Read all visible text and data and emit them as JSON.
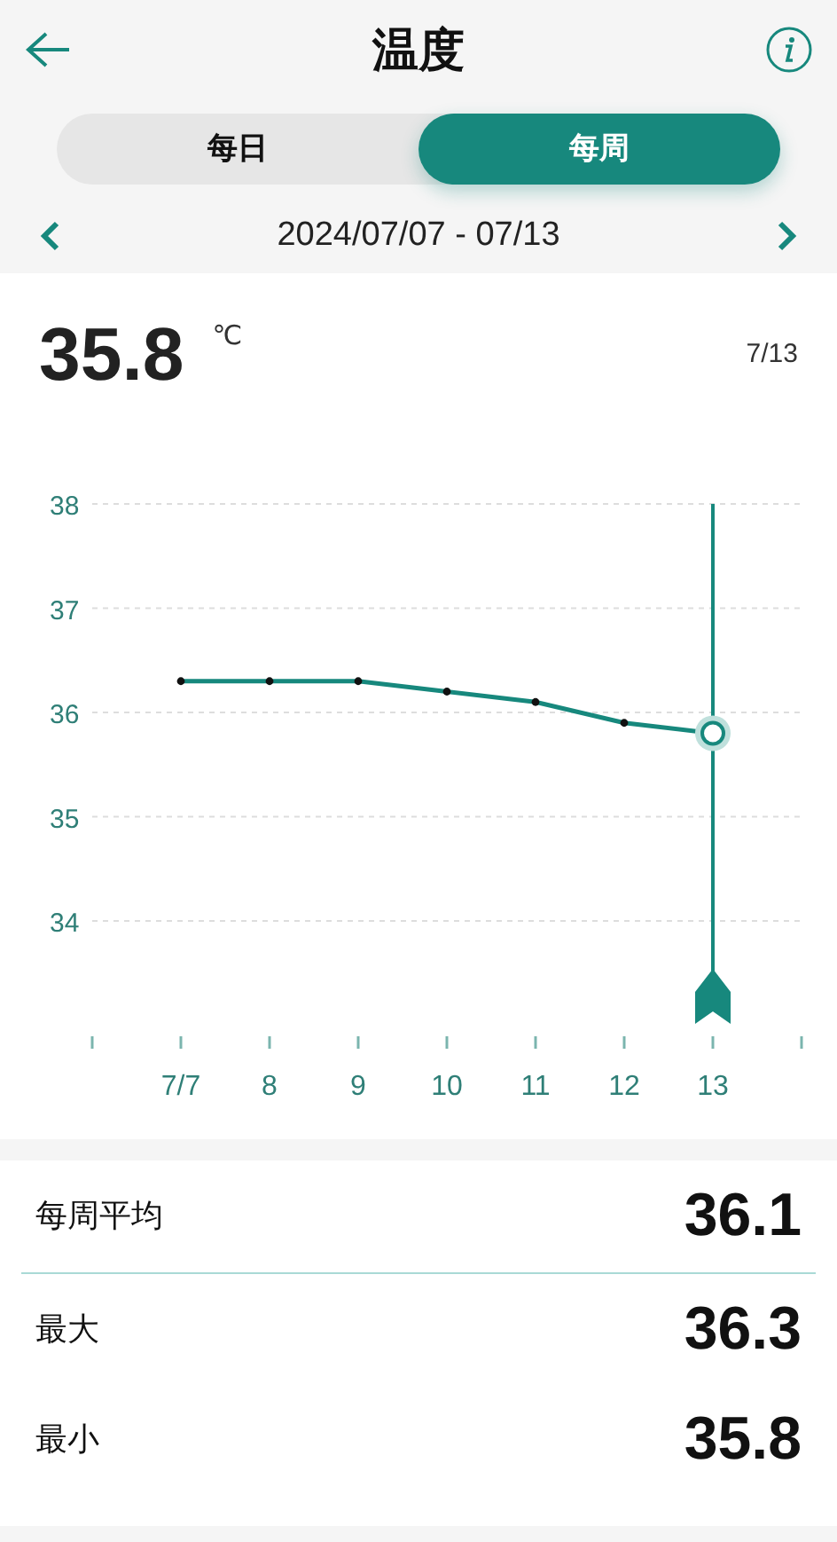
{
  "header": {
    "title": "温度"
  },
  "tabs": [
    {
      "label": "每日",
      "selected": false
    },
    {
      "label": "每周",
      "selected": true
    }
  ],
  "date_range": "2024/07/07 - 07/13",
  "reading": {
    "value": "35.8",
    "unit": "℃",
    "date": "7/13"
  },
  "chart_data": {
    "type": "line",
    "categories": [
      "7/7",
      "8",
      "9",
      "10",
      "11",
      "12",
      "13"
    ],
    "series": [
      {
        "color": "#17887d",
        "values": [
          36.3,
          36.3,
          36.3,
          36.2,
          36.1,
          35.9,
          35.8
        ]
      }
    ],
    "ylim": [
      34,
      38
    ],
    "yticks": [
      34,
      35,
      36,
      37,
      38
    ],
    "grid": true,
    "marker": true,
    "ref_lines": [
      {
        "axis": "x",
        "value": "13",
        "color": "#17887d"
      }
    ]
  },
  "stats": [
    {
      "label": "每周平均",
      "value": "36.1"
    },
    {
      "label": "最大",
      "value": "36.3"
    },
    {
      "label": "最小",
      "value": "35.8"
    }
  ]
}
